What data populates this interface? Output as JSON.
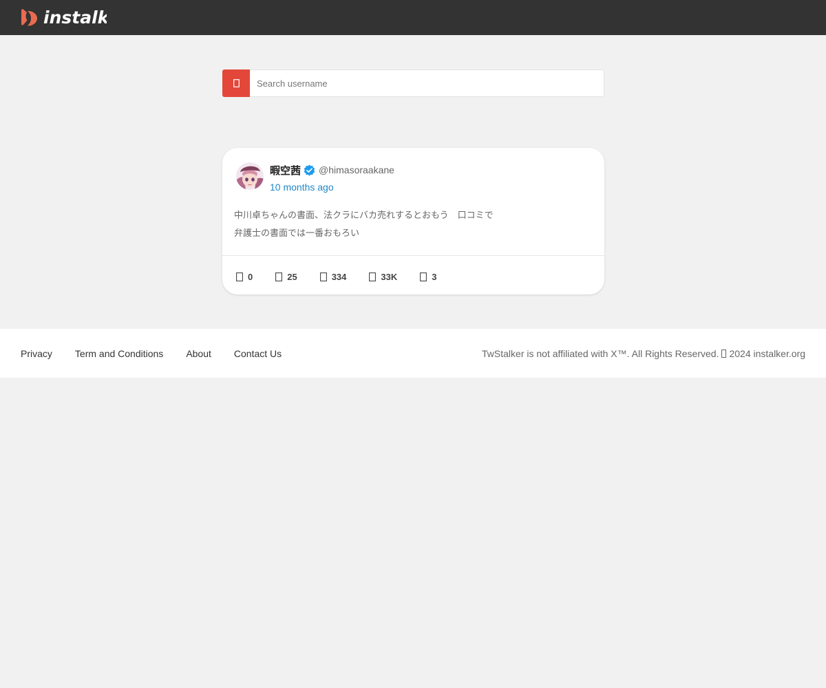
{
  "header": {
    "logo_text": "instalk",
    "brand_color": "#e96b50",
    "background": "#333333"
  },
  "search": {
    "placeholder": "Search username",
    "value": "",
    "button_icon": "search-icon",
    "button_color": "#e2473a"
  },
  "tweet": {
    "display_name": "暇空茜",
    "verified": true,
    "handle": "@himasoraakane",
    "timestamp": "10 months ago",
    "text_lines": [
      "中川卓ちゃんの書面、法クラにバカ売れするとおもう　口コミで",
      "弁護士の書面では一番おもろい"
    ],
    "stats": [
      {
        "icon": "reply-icon",
        "value": "0"
      },
      {
        "icon": "retweet-icon",
        "value": "25"
      },
      {
        "icon": "like-icon",
        "value": "334"
      },
      {
        "icon": "views-icon",
        "value": "33K"
      },
      {
        "icon": "bookmark-icon",
        "value": "3"
      }
    ]
  },
  "footer": {
    "links": [
      "Privacy",
      "Term and Conditions",
      "About",
      "Contact Us"
    ],
    "copyright_prefix": "TwStalker is not affiliated with X™. All Rights Reserved.",
    "copyright_suffix": "2024 instalker.org"
  }
}
